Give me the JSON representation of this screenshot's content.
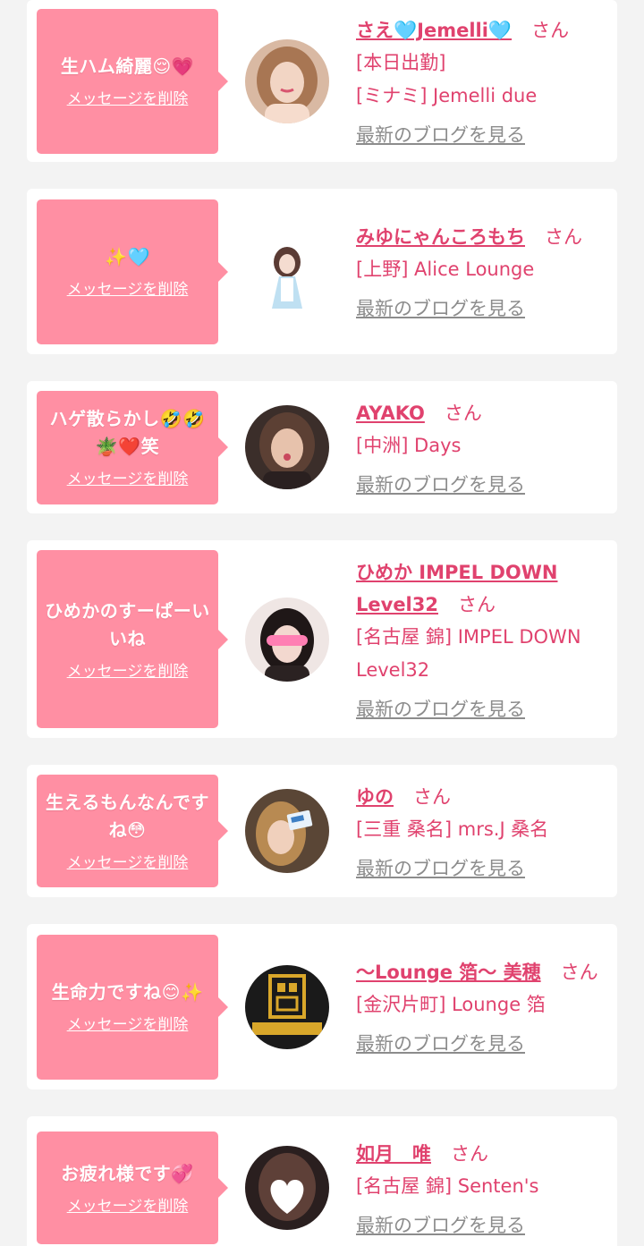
{
  "common": {
    "delete_label": "メッセージを削除",
    "blog_label": "最新のブログを見る",
    "san_suffix": "さん"
  },
  "colors": {
    "background": "#f3f3f3",
    "card": "#ffffff",
    "bubble": "#ff8fa3",
    "accent": "#e0426e",
    "muted_link": "#8c8c8c"
  },
  "cards": [
    {
      "message": "生ハム綺麗😌💗",
      "name": "さえ🩵Jemelli🩵",
      "shop_lines": [
        "[本日出勤]",
        "[ミナミ] Jemelli due"
      ],
      "avatar_icon": "avatar-woman-photo"
    },
    {
      "message": "✨🩵",
      "name": "みゆにゃんころもち",
      "shop_lines": [
        "[上野] Alice Lounge"
      ],
      "avatar_icon": "avatar-maid-photo"
    },
    {
      "message": "ハゲ散らかし🤣🤣🪴❤️笑",
      "name": "AYAKO",
      "shop_lines": [
        "[中洲] Days"
      ],
      "avatar_icon": "avatar-woman-photo"
    },
    {
      "message": "ひめかのすーぱーいいね",
      "name": "ひめか IMPEL DOWN Level32",
      "shop_lines": [
        "[名古屋 錦] IMPEL DOWN Level32"
      ],
      "avatar_icon": "avatar-woman-photo"
    },
    {
      "message": "生えるもんなんですね😳",
      "name": "ゆの",
      "shop_lines": [
        "[三重 桑名] mrs.J 桑名"
      ],
      "avatar_icon": "avatar-woman-photo"
    },
    {
      "message": "生命力ですね😊✨",
      "name": "〜Lounge 箔〜 美穂",
      "shop_lines": [
        "[金沢片町] Lounge 箔"
      ],
      "avatar_icon": "avatar-lounge-logo"
    },
    {
      "message": "お疲れ様です💞",
      "name": "如月　唯",
      "shop_lines": [
        "[名古屋 錦] Senten's"
      ],
      "avatar_icon": "avatar-heart-photo"
    }
  ]
}
